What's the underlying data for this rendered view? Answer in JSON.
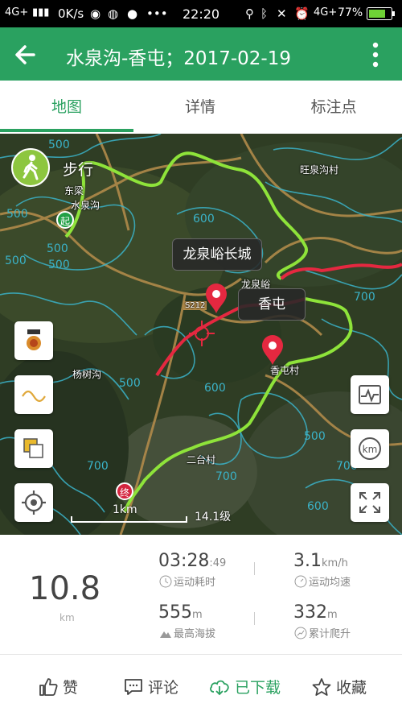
{
  "status_bar": {
    "network": "4G+",
    "speed": "0K/s",
    "dots": "•••",
    "time": "22:20",
    "network2": "4G+",
    "battery": "77%"
  },
  "app_bar": {
    "title": "水泉沟-香屯；2017-02-19"
  },
  "tabs": [
    {
      "label": "地图",
      "active": true
    },
    {
      "label": "详情",
      "active": false
    },
    {
      "label": "标注点",
      "active": false
    }
  ],
  "map": {
    "activity": "步行",
    "callouts": [
      "龙泉峪长城",
      "香屯"
    ],
    "start_label": "起",
    "end_label": "终",
    "place_labels": [
      "旺泉沟村",
      "东梁",
      "水泉沟",
      "龙泉峪",
      "杨树沟",
      "香屯村",
      "二台村",
      "S212"
    ],
    "contour_values": [
      "500",
      "500",
      "500",
      "500",
      "600",
      "500",
      "700",
      "500",
      "600",
      "700",
      "600",
      "700",
      "500",
      "500",
      "700"
    ],
    "scale_label": "1km",
    "zoom_label": "14.1级"
  },
  "stats": {
    "distance": "10.8",
    "distance_unit": "km",
    "duration_main": "03:28",
    "duration_sec": ":49",
    "duration_label": "运动耗时",
    "speed_value": "3.1",
    "speed_unit": "km/h",
    "speed_label": "运动均速",
    "altitude_value": "555",
    "altitude_unit": "m",
    "altitude_label": "最高海拔",
    "climb_value": "332",
    "climb_unit": "m",
    "climb_label": "累计爬升"
  },
  "bottom_bar": {
    "like": "赞",
    "comment": "评论",
    "downloaded": "已下载",
    "favorite": "收藏"
  },
  "colors": {
    "brand_green": "#2aa160",
    "track_green": "#8ee33a",
    "track_red": "#e52840",
    "contour": "#3ab3c9"
  }
}
